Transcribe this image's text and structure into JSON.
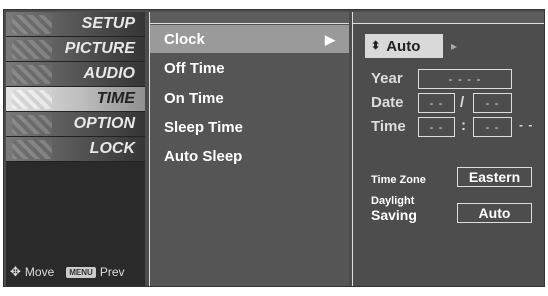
{
  "left_menu": [
    {
      "label": "SETUP",
      "icon": "satellite-dish-icon"
    },
    {
      "label": "PICTURE",
      "icon": "film-reel-icon"
    },
    {
      "label": "AUDIO",
      "icon": "speaker-icon"
    },
    {
      "label": "TIME",
      "icon": "clock-icon"
    },
    {
      "label": "OPTION",
      "icon": "option-tag-icon"
    },
    {
      "label": "LOCK",
      "icon": "lock-icon"
    }
  ],
  "footer": {
    "move_icon": "✥",
    "move_label": "Move",
    "menu_badge": "MENU",
    "prev_label": "Prev"
  },
  "mid_menu": [
    {
      "label": "Clock",
      "arrow": "▶"
    },
    {
      "label": "Off Time"
    },
    {
      "label": "On Time"
    },
    {
      "label": "Sleep Time"
    },
    {
      "label": "Auto Sleep"
    }
  ],
  "clock": {
    "mode_updown": "⬍",
    "mode_value": "Auto",
    "mode_next": "▸",
    "year_label": "Year",
    "year_value": "- - - -",
    "date_label": "Date",
    "date_month": "- -",
    "date_sep": "/",
    "date_day": "- -",
    "time_label": "Time",
    "time_hour": "- -",
    "time_sep": ":",
    "time_min": "- -",
    "time_ampm": "- -",
    "timezone_label": "Time Zone",
    "timezone_value": "Eastern",
    "dst_label_1": "Daylight",
    "dst_label_2": "Saving",
    "dst_value": "Auto"
  },
  "colors": {
    "background": "#4c4c4c",
    "highlight": "#9a9a9a"
  }
}
